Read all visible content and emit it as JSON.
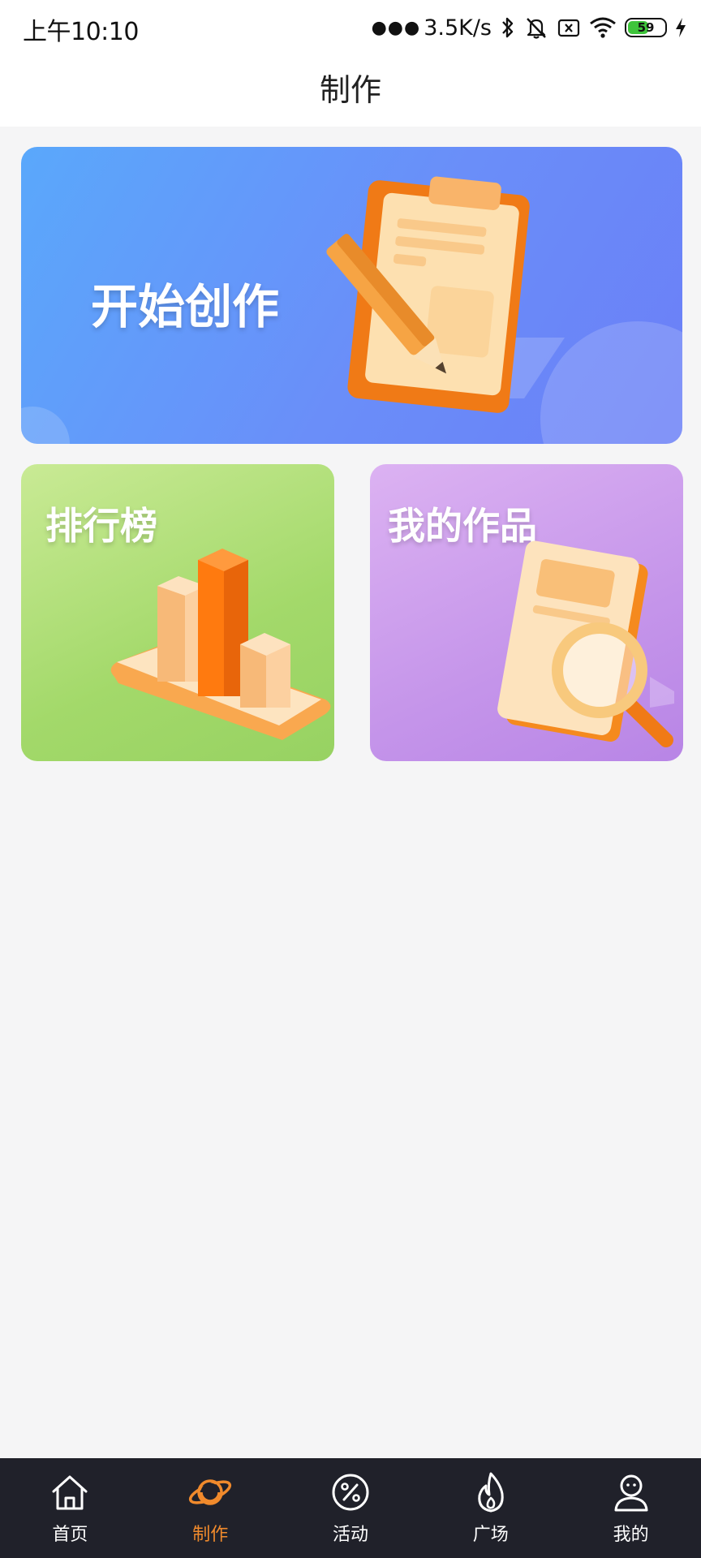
{
  "status_bar": {
    "time": "上午10:10",
    "network_speed": "3.5K/s",
    "battery_level": "59",
    "battery_fill_fraction": 0.59
  },
  "header": {
    "title": "制作"
  },
  "cards": {
    "start": {
      "label": "开始创作",
      "icon": "clipboard-pencil-illustration"
    },
    "rank": {
      "label": "排行榜",
      "icon": "bar-chart-illustration"
    },
    "works": {
      "label": "我的作品",
      "icon": "book-magnifier-illustration"
    }
  },
  "bottom_nav": {
    "items": [
      {
        "label": "首页",
        "icon": "home-icon",
        "active": false
      },
      {
        "label": "制作",
        "icon": "planet-icon",
        "active": true
      },
      {
        "label": "活动",
        "icon": "percent-icon",
        "active": false
      },
      {
        "label": "广场",
        "icon": "flame-icon",
        "active": false
      },
      {
        "label": "我的",
        "icon": "person-icon",
        "active": false
      }
    ]
  },
  "colors": {
    "accent": "#f08a2c",
    "nav_background": "#20212a",
    "battery_green": "#3ec43b"
  }
}
